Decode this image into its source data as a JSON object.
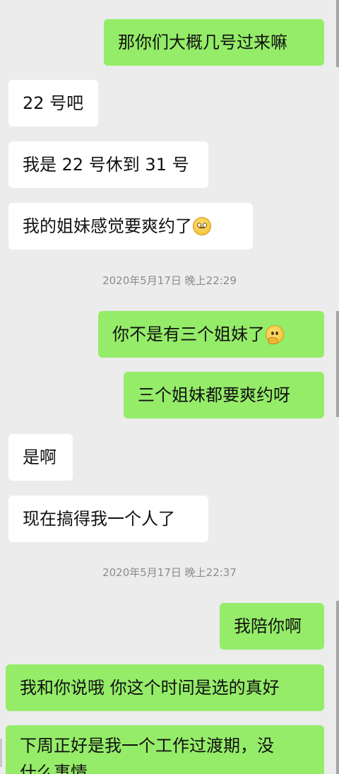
{
  "messages": [
    {
      "side": "out",
      "text": "那你们大概几号过来嘛"
    },
    {
      "side": "in",
      "text": "22 号吧"
    },
    {
      "side": "in",
      "text": "我是 22 号休到 31 号"
    },
    {
      "side": "in",
      "text": "我的姐妹感觉要爽约了",
      "emoji": "worried-face-icon"
    },
    {
      "side": "out",
      "text": "你不是有三个姐妹了",
      "emoji": "thinking-face-icon"
    },
    {
      "side": "out",
      "text": "三个姐妹都要爽约呀"
    },
    {
      "side": "in",
      "text": "是啊"
    },
    {
      "side": "in",
      "text": "现在搞得我一个人了"
    },
    {
      "side": "out",
      "text": "我陪你啊"
    },
    {
      "side": "out",
      "text": "我和你说哦 你这个时间是选的真好"
    },
    {
      "side": "out",
      "text": "下周正好是我一个工作过渡期，没",
      "continuation": "什么事情"
    }
  ],
  "timestamps": [
    "2020年5月17日 晚上22:29",
    "2020年5月17日 晚上22:37"
  ],
  "colors": {
    "background": "#ececec",
    "outgoing_bubble": "#95ec69",
    "incoming_bubble": "#ffffff",
    "timestamp_text": "#8c8c8c"
  }
}
